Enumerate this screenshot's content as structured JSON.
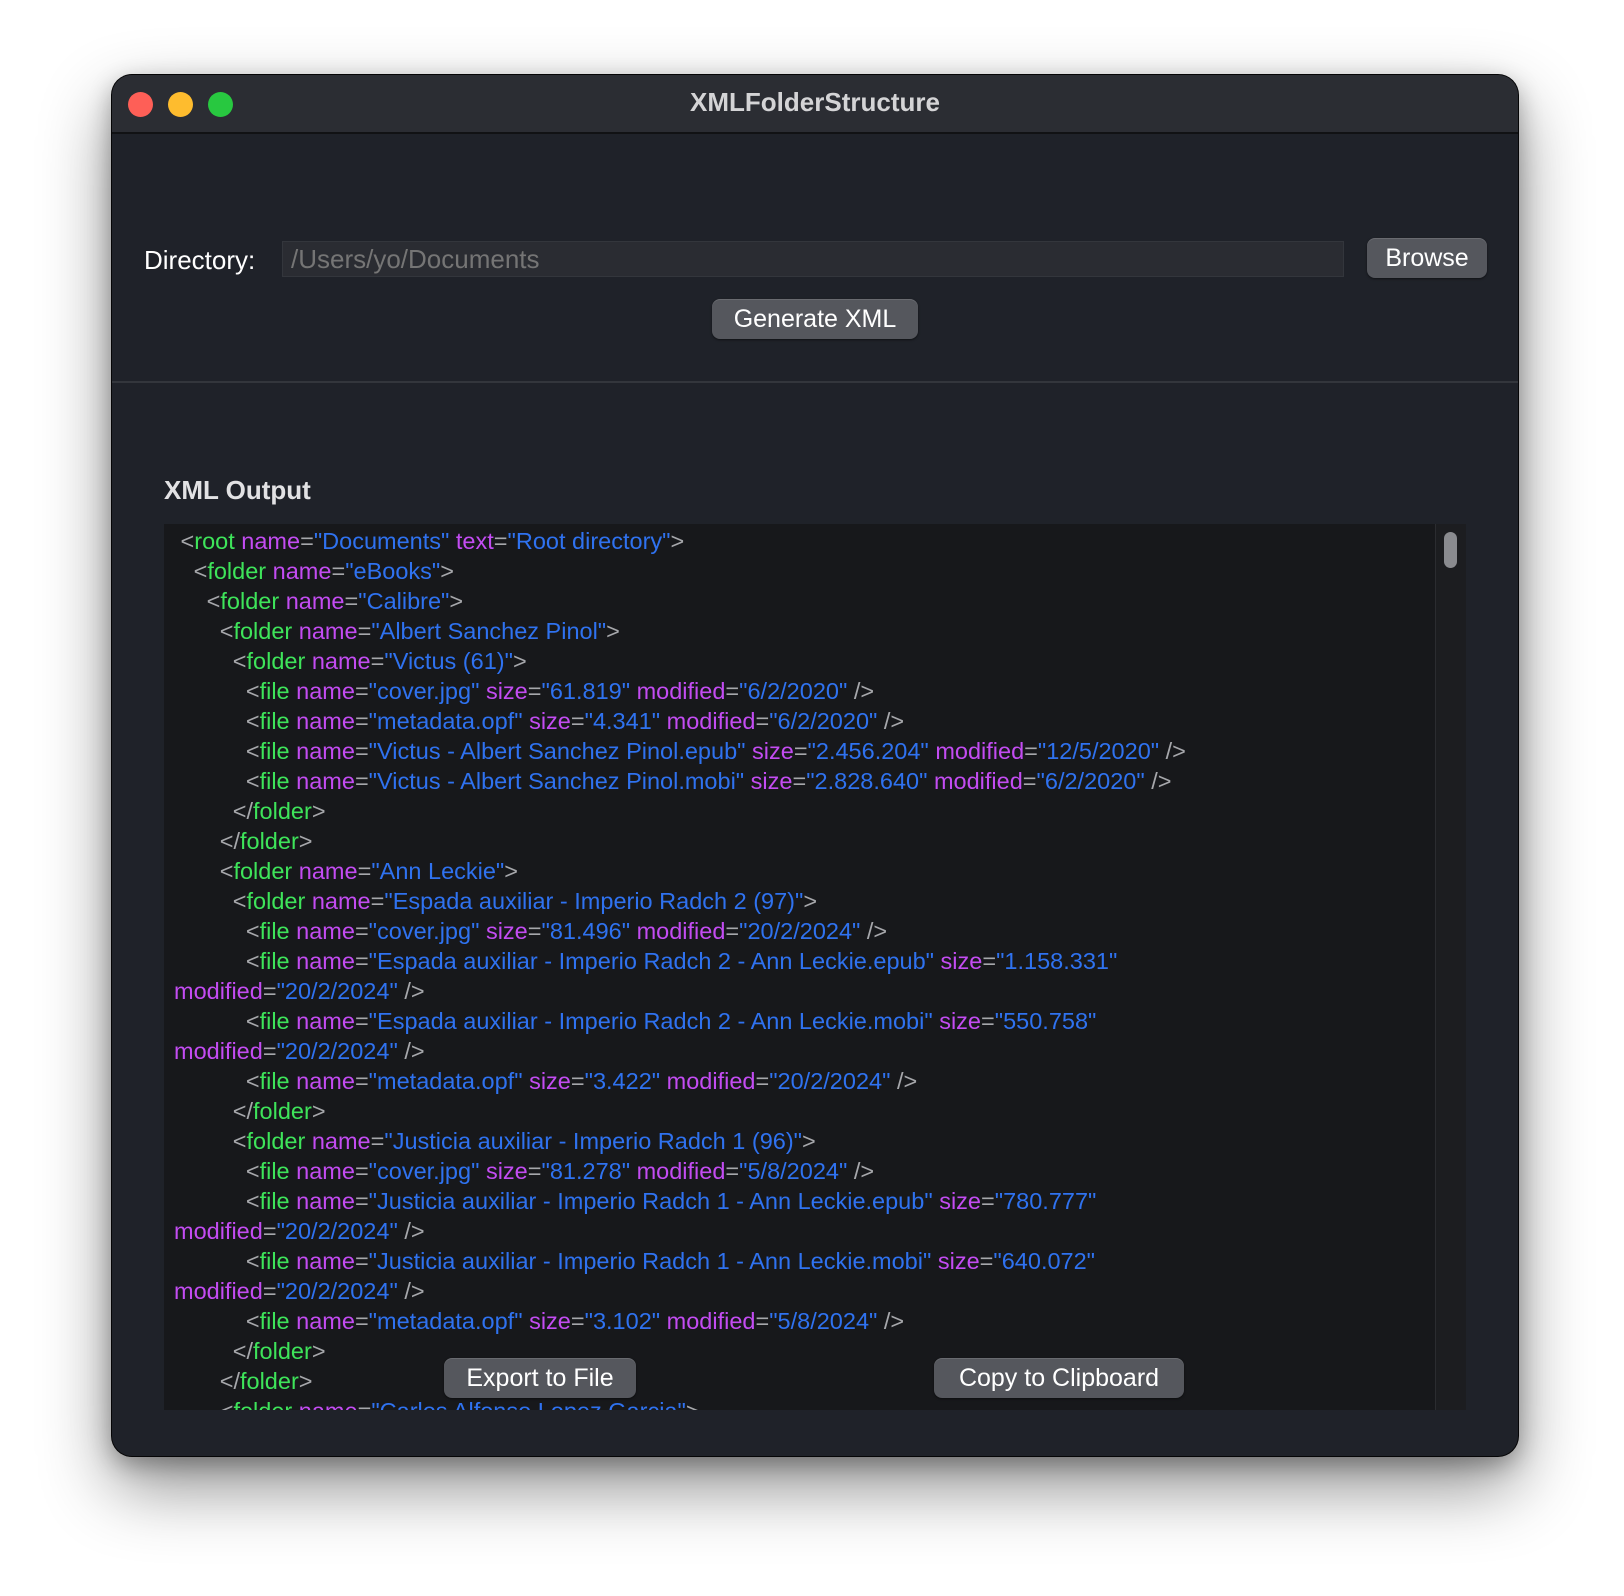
{
  "window": {
    "title": "XMLFolderStructure",
    "colors": {
      "close": "#fe5f57",
      "minimize": "#febc2e",
      "maximize": "#28c840"
    }
  },
  "directory": {
    "label": "Directory:",
    "placeholder": "/Users/yo/Documents",
    "value": ""
  },
  "buttons": {
    "browse": "Browse",
    "generate": "Generate XML",
    "export": "Export to File",
    "copy": "Copy to Clipboard"
  },
  "output": {
    "heading": "XML Output",
    "syntax_colors": {
      "tag": "#3ee45a",
      "attribute": "#c34cf2",
      "value": "#2f72f0",
      "punctuation": "#a6a7ab"
    },
    "lines": [
      " <root name=\"Documents\" text=\"Root directory\">",
      "   <folder name=\"eBooks\">",
      "     <folder name=\"Calibre\">",
      "       <folder name=\"Albert Sanchez Pinol\">",
      "         <folder name=\"Victus (61)\">",
      "           <file name=\"cover.jpg\" size=\"61.819\" modified=\"6/2/2020\" />",
      "           <file name=\"metadata.opf\" size=\"4.341\" modified=\"6/2/2020\" />",
      "           <file name=\"Victus - Albert Sanchez Pinol.epub\" size=\"2.456.204\" modified=\"12/5/2020\" />",
      "           <file name=\"Victus - Albert Sanchez Pinol.mobi\" size=\"2.828.640\" modified=\"6/2/2020\" />",
      "         </folder>",
      "       </folder>",
      "       <folder name=\"Ann Leckie\">",
      "         <folder name=\"Espada auxiliar - Imperio Radch 2 (97)\">",
      "           <file name=\"cover.jpg\" size=\"81.496\" modified=\"20/2/2024\" />",
      "           <file name=\"Espada auxiliar - Imperio Radch 2 - Ann Leckie.epub\" size=\"1.158.331\"",
      "modified=\"20/2/2024\" />",
      "           <file name=\"Espada auxiliar - Imperio Radch 2 - Ann Leckie.mobi\" size=\"550.758\"",
      "modified=\"20/2/2024\" />",
      "           <file name=\"metadata.opf\" size=\"3.422\" modified=\"20/2/2024\" />",
      "         </folder>",
      "         <folder name=\"Justicia auxiliar - Imperio Radch 1 (96)\">",
      "           <file name=\"cover.jpg\" size=\"81.278\" modified=\"5/8/2024\" />",
      "           <file name=\"Justicia auxiliar - Imperio Radch 1 - Ann Leckie.epub\" size=\"780.777\"",
      "modified=\"20/2/2024\" />",
      "           <file name=\"Justicia auxiliar - Imperio Radch 1 - Ann Leckie.mobi\" size=\"640.072\"",
      "modified=\"20/2/2024\" />",
      "           <file name=\"metadata.opf\" size=\"3.102\" modified=\"5/8/2024\" />",
      "         </folder>",
      "       </folder>",
      "       <folder name=\"Carlos Alfonso Lopez Garcia\">"
    ]
  }
}
